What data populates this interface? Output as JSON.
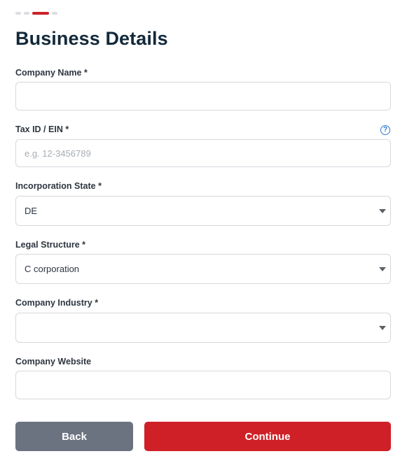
{
  "progress": {
    "step_count": 4,
    "current_step": 3
  },
  "header": {
    "title": "Business Details"
  },
  "form": {
    "company_name": {
      "label": "Company Name *",
      "value": ""
    },
    "tax_id": {
      "label": "Tax ID / EIN *",
      "value": "",
      "placeholder": "e.g. 12-3456789",
      "help_icon": "question-circle-icon"
    },
    "incorporation_state": {
      "label": "Incorporation State *",
      "value": "DE"
    },
    "legal_structure": {
      "label": "Legal Structure *",
      "value": "C corporation"
    },
    "company_industry": {
      "label": "Company Industry *",
      "value": ""
    },
    "company_website": {
      "label": "Company Website",
      "value": ""
    }
  },
  "actions": {
    "back_label": "Back",
    "continue_label": "Continue"
  },
  "colors": {
    "accent": "#cf2027",
    "secondary_button": "#6b7280",
    "help_icon": "#2a7ad3",
    "title": "#13293a"
  }
}
